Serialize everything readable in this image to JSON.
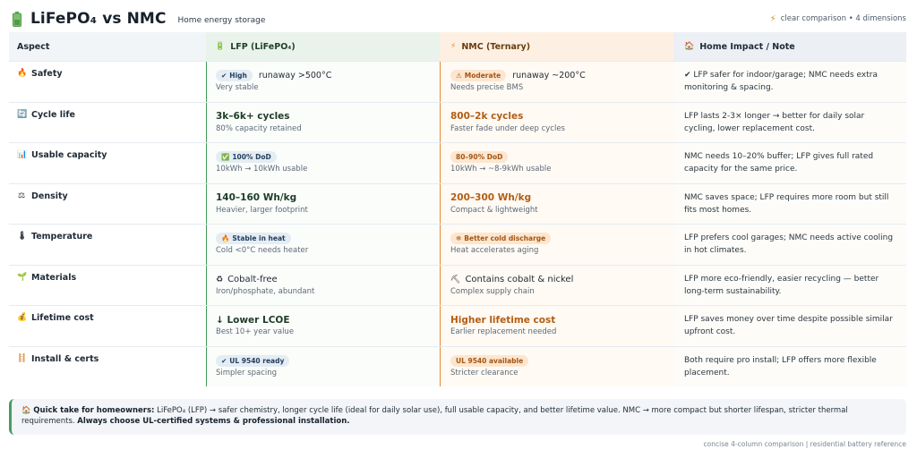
{
  "header": {
    "logo_icon": "battery-icon",
    "title": "LiFePO₄ vs NMC",
    "subtitle": "Home energy storage",
    "right_icon": "lightning-icon",
    "right_text": "clear comparison • 4 dimensions"
  },
  "columns": [
    {
      "icon": "",
      "label": "Aspect"
    },
    {
      "icon": "battery-icon",
      "label": "LFP (LiFePO₄)"
    },
    {
      "icon": "lightning-icon",
      "label": "NMC (Ternary)"
    },
    {
      "icon": "house-icon",
      "label": "Home Impact / Note"
    }
  ],
  "rows": [
    {
      "aspect": "Safety",
      "aspect_icon": "flame-icon",
      "lfp": {
        "pill": "High",
        "pill_icon": "check-icon",
        "inline": "runaway >500°C",
        "sub": "Very stable"
      },
      "nmc": {
        "pill": "Moderate",
        "pill_icon": "warning-icon",
        "inline": "runaway ~200°C",
        "sub": "Needs precise BMS"
      },
      "note": "✔ LFP safer for indoor/garage; NMC needs extra monitoring & spacing."
    },
    {
      "aspect": "Cycle life",
      "aspect_icon": "cycle-icon",
      "lfp": {
        "big": "3k–6k+ cycles",
        "sub": "80% capacity retained"
      },
      "nmc": {
        "big": "800–2k cycles",
        "sub": "Faster fade under deep cycles"
      },
      "note": "LFP lasts 2-3× longer → better for daily solar cycling, lower replacement cost."
    },
    {
      "aspect": "Usable capacity",
      "aspect_icon": "bar-chart-icon",
      "lfp": {
        "pill": "100% DoD",
        "pill_icon": "check-box-icon",
        "sub": "10kWh → 10kWh usable"
      },
      "nmc": {
        "pill": "80–90% DoD",
        "sub": "10kWh → ~8-9kWh usable"
      },
      "note": "NMC needs 10–20% buffer; LFP gives full rated capacity for the same price."
    },
    {
      "aspect": "Density",
      "aspect_icon": "scale-icon",
      "lfp": {
        "big": "140–160 Wh/kg",
        "sub": "Heavier, larger footprint"
      },
      "nmc": {
        "big": "200–300 Wh/kg",
        "sub": "Compact & lightweight"
      },
      "note": "NMC saves space; LFP requires more room but still fits most homes."
    },
    {
      "aspect": "Temperature",
      "aspect_icon": "thermometer-icon",
      "lfp": {
        "pill": "Stable in heat",
        "pill_icon": "flame-icon",
        "sub": "Cold <0°C needs heater"
      },
      "nmc": {
        "pill": "Better cold discharge",
        "pill_icon": "snowflake-icon",
        "sub": "Heat accelerates aging"
      },
      "note": "LFP prefers cool garages; NMC needs active cooling in hot climates."
    },
    {
      "aspect": "Materials",
      "aspect_icon": "plant-icon",
      "lfp": {
        "plain": "Cobalt-free",
        "plain_icon": "recycle-icon",
        "sub": "Iron/phosphate, abundant"
      },
      "nmc": {
        "plain": "Contains cobalt & nickel",
        "plain_icon": "pickaxe-icon",
        "sub": "Complex supply chain"
      },
      "note": "LFP more eco-friendly, easier recycling — better long-term sustainability."
    },
    {
      "aspect": "Lifetime cost",
      "aspect_icon": "money-bag-icon",
      "lfp": {
        "big": "↓ Lower LCOE",
        "sub": "Best 10+ year value"
      },
      "nmc": {
        "big": "Higher lifetime cost",
        "sub": "Earlier replacement needed"
      },
      "note": "LFP saves money over time despite possible similar upfront cost."
    },
    {
      "aspect": "Install & certs",
      "aspect_icon": "ladder-icon",
      "lfp": {
        "pill": "UL 9540 ready",
        "pill_icon": "check-icon",
        "sub": "Simpler spacing"
      },
      "nmc": {
        "pill": "UL 9540 available",
        "sub": "Stricter clearance"
      },
      "note": "Both require pro install; LFP offers more flexible placement."
    }
  ],
  "quick": {
    "icon": "house-icon",
    "label": "Quick take for homeowners:",
    "text": " LiFePO₄ (LFP) → safer chemistry, longer cycle life (ideal for daily solar use), full usable capacity, and better lifetime value. NMC → more compact but shorter lifespan, stricter thermal requirements.",
    "emphasis": "Always choose UL-certified systems & professional installation."
  },
  "footer": "concise 4-column comparison | residential battery reference",
  "colors": {
    "lfp": "#3f9a55",
    "nmc": "#e68a2c"
  }
}
